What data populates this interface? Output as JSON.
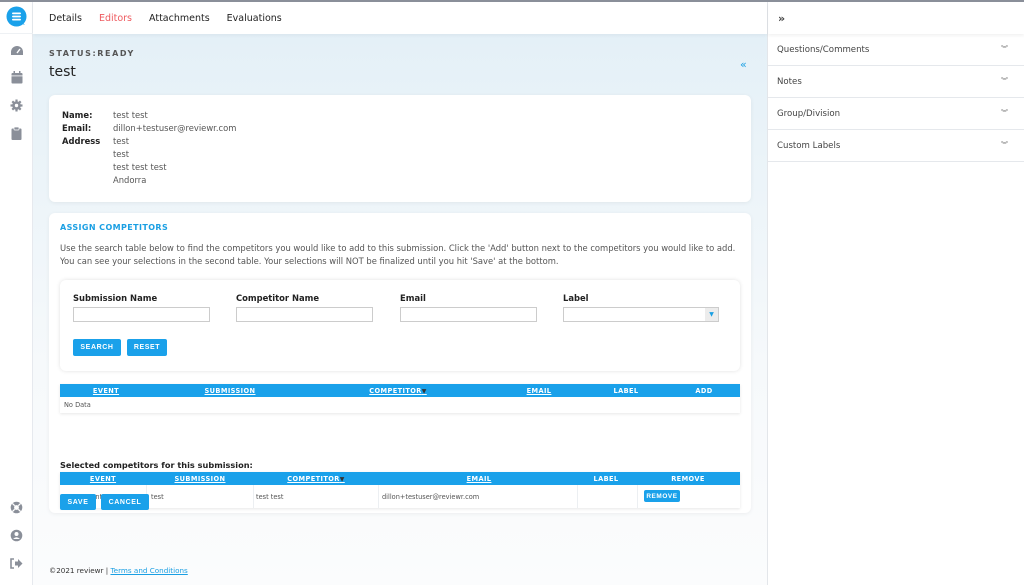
{
  "tabs": [
    {
      "label": "Details",
      "active": false
    },
    {
      "label": "Editors",
      "active": true
    },
    {
      "label": "Attachments",
      "active": false
    },
    {
      "label": "Evaluations",
      "active": false
    }
  ],
  "rail": {
    "icons": [
      "logo-icon",
      "dashboard-icon",
      "calendar-icon",
      "gear-icon",
      "clipboard-icon",
      "help-icon",
      "user-icon",
      "logout-icon"
    ]
  },
  "status_label": "STATUS:READY",
  "page_title": "test",
  "collapse_icon": "«",
  "info": {
    "name_label": "Name:",
    "name_value": "test test",
    "email_label": "Email:",
    "email_value": "dillon+testuser@reviewr.com",
    "address_label": "Address",
    "address_lines": [
      "test",
      "test",
      "test test test",
      "Andorra"
    ]
  },
  "assign": {
    "title": "ASSIGN COMPETITORS",
    "description": "Use the search table below to find the competitors you would like to add to this submission. Click the 'Add' button next to the competitors you would like to add. You can see your selections in the second table. Your selections will NOT be finalized until you hit 'Save' at the bottom.",
    "filters": {
      "submission_name_label": "Submission Name",
      "submission_name_value": "",
      "competitor_name_label": "Competitor Name",
      "competitor_name_value": "",
      "email_label": "Email",
      "email_value": "",
      "label_label": "Label",
      "label_value": ""
    },
    "search_button": "SEARCH",
    "reset_button": "RESET",
    "search_table": {
      "columns": [
        "EVENT",
        "SUBMISSION",
        "COMPETITOR",
        "EMAIL",
        "LABEL",
        "ADD"
      ],
      "empty_text": "No Data"
    },
    "selected_title": "Selected competitors for this submission:",
    "selected_table": {
      "columns": [
        "EVENT",
        "SUBMISSION",
        "COMPETITOR",
        "EMAIL",
        "LABEL",
        "REMOVE"
      ],
      "rows": [
        {
          "event": "0Test Event",
          "submission": "test",
          "competitor": "test test",
          "email": "dillon+testuser@reviewr.com",
          "label": "",
          "remove_label": "REMOVE"
        }
      ]
    },
    "save_button": "SAVE",
    "cancel_button": "CANCEL"
  },
  "footer": {
    "copyright": "©2021 reviewr | ",
    "terms_link": "Terms and Conditions"
  },
  "right_panel": {
    "expand_icon": "»",
    "items": [
      {
        "label": "Questions/Comments"
      },
      {
        "label": "Notes"
      },
      {
        "label": "Group/Division"
      },
      {
        "label": "Custom Labels"
      }
    ],
    "chevron": "⌄"
  },
  "colors": {
    "accent": "#1aa1ea",
    "active_tab": "#ee5a5f"
  }
}
